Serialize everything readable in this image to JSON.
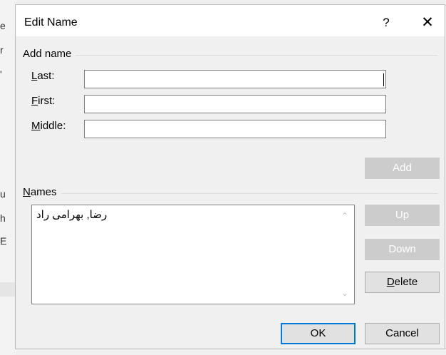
{
  "background": {
    "fragments": [
      "e",
      "r",
      "'",
      "u",
      "h",
      "E"
    ]
  },
  "dialog": {
    "title": "Edit Name",
    "help_label": "?",
    "close_label": "✕"
  },
  "add_name": {
    "group_label": "Add name",
    "last_label_accel": "L",
    "last_label_rest": "ast:",
    "first_label_accel": "F",
    "first_label_rest": "irst:",
    "middle_label_accel": "M",
    "middle_label_rest": "iddle:",
    "last_value": "",
    "first_value": "",
    "middle_value": "",
    "add_button": "Add"
  },
  "names": {
    "group_label_accel": "N",
    "group_label_rest": "ames",
    "items": [
      "رضا, بهرامی راد"
    ],
    "up_button": "Up",
    "down_button": "Down",
    "delete_accel": "D",
    "delete_rest": "elete"
  },
  "footer": {
    "ok_button": "OK",
    "cancel_button": "Cancel"
  },
  "colors": {
    "focus_border": "#0078d7",
    "disabled_button": "#cccccc"
  }
}
